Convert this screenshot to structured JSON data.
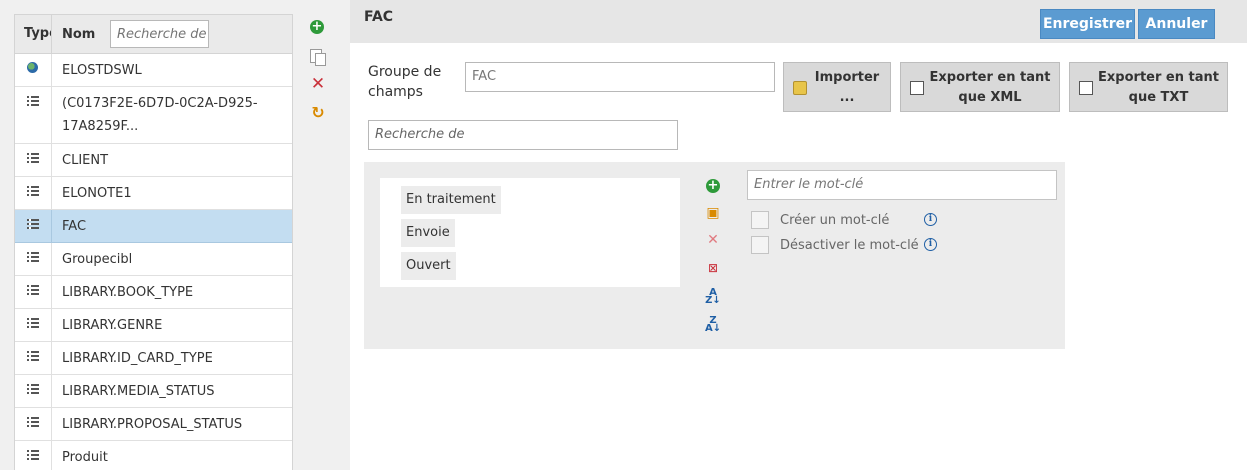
{
  "left_table": {
    "col_type": "Type",
    "col_name": "Nom",
    "search_placeholder": "Recherche de",
    "rows": [
      {
        "icon": "globe-icon",
        "name": "ELOSTDSWL"
      },
      {
        "icon": "list-icon",
        "name": "(C0173F2E-6D7D-0C2A-D925-17A8259F..."
      },
      {
        "icon": "list-icon",
        "name": "CLIENT"
      },
      {
        "icon": "list-icon",
        "name": "ELONOTE1"
      },
      {
        "icon": "list-icon",
        "name": "FAC",
        "selected": true
      },
      {
        "icon": "list-icon",
        "name": "Groupecibl"
      },
      {
        "icon": "list-icon",
        "name": "LIBRARY.BOOK_TYPE"
      },
      {
        "icon": "list-icon",
        "name": "LIBRARY.GENRE"
      },
      {
        "icon": "list-icon",
        "name": "LIBRARY.ID_CARD_TYPE"
      },
      {
        "icon": "list-icon",
        "name": "LIBRARY.MEDIA_STATUS"
      },
      {
        "icon": "list-icon",
        "name": "LIBRARY.PROPOSAL_STATUS"
      },
      {
        "icon": "list-icon",
        "name": "Produit"
      }
    ]
  },
  "side_tools": [
    "add-icon",
    "copy-icon",
    "delete-icon",
    "refresh-icon"
  ],
  "header": {
    "title": "FAC",
    "save_label": "Enregistrer",
    "cancel_label": "Annuler"
  },
  "form": {
    "field_group_label": "Groupe de champs",
    "field_group_value": "FAC",
    "import_label": "Importer ...",
    "export_xml_label": "Exporter en tant que XML",
    "export_txt_label": "Exporter en tant que TXT",
    "search_placeholder": "Recherche de"
  },
  "keywords": {
    "items": [
      "En traitement",
      "Envoie",
      "Ouvert"
    ],
    "input_placeholder": "Entrer le mot-clé",
    "create_keyword_label": "Créer un mot-clé",
    "disable_keyword_label": "Désactiver le mot-clé",
    "create_keyword_checked": false,
    "disable_keyword_checked": false
  },
  "colors": {
    "accent": "#5b9bd1",
    "selected_row": "#c3ddf1",
    "add_green": "#2e9a3a",
    "delete_red": "#c9303a"
  }
}
